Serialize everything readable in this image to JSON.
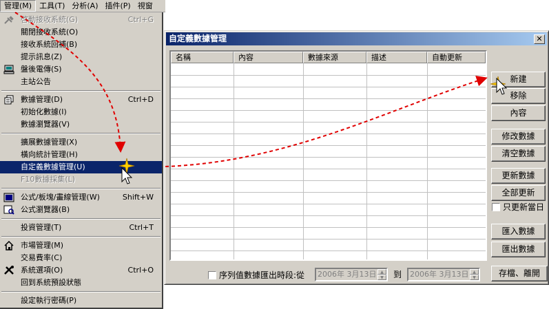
{
  "menubar": {
    "items": [
      {
        "label": "管理(M)"
      },
      {
        "label": "工具(T)"
      },
      {
        "label": "分析(A)"
      },
      {
        "label": "插件(P)"
      },
      {
        "label": "視窗"
      }
    ]
  },
  "menu": {
    "items": [
      {
        "label": "啓動接收系統(G)",
        "shortcut": "Ctrl+G",
        "icon": "plug-icon",
        "disabled": true
      },
      {
        "label": "關閉接收系統(O)"
      },
      {
        "label": "接收系統回補(B)"
      },
      {
        "label": "提示訊息(Z)"
      },
      {
        "label": "盤後電傳(S)",
        "icon": "computer-icon"
      },
      {
        "label": "主站公告"
      },
      {
        "label": "數據管理(D)",
        "shortcut": "Ctrl+D",
        "icon": "database-icon"
      },
      {
        "label": "初始化數據(I)"
      },
      {
        "label": "數據瀏覽器(V)"
      },
      {
        "label": "擴展數據管理(X)"
      },
      {
        "label": "橫向統計管理(H)"
      },
      {
        "label": "自定義數據管理(U)"
      },
      {
        "label": "F10數據採集(L)",
        "disabled": true
      },
      {
        "label": "公式/板塊/畫線管理(W)",
        "shortcut": "Shift+W",
        "icon": "formula-icon"
      },
      {
        "label": "公式瀏覽器(B)",
        "icon": "browser-icon"
      },
      {
        "label": "投資管理(T)",
        "shortcut": "Ctrl+T"
      },
      {
        "label": "市場管理(M)",
        "icon": "home-icon"
      },
      {
        "label": "交易費率(C)"
      },
      {
        "label": "系統選項(O)",
        "shortcut": "Ctrl+O",
        "icon": "tools-icon"
      },
      {
        "label": "回到系統預設狀態"
      },
      {
        "label": "設定執行密碼(P)"
      }
    ]
  },
  "dialog": {
    "title": "自定義數據管理",
    "close_glyph": "✕",
    "columns": [
      "名稱",
      "內容",
      "數據來源",
      "描述",
      "自動更新"
    ],
    "buttons": {
      "new": "新建",
      "delete": "移除",
      "content": "內容",
      "modify": "修改數據",
      "clear": "清空數據",
      "update": "更新數據",
      "update_all": "全部更新",
      "only_today": "只更新當日",
      "import": "匯入數據",
      "export": "匯出數據",
      "save_exit": "存檔、離開"
    },
    "range_label": "序列值數據匯出時段:從",
    "date_from": "2006年  3月13日",
    "to_label": "到",
    "date_to": "2006年  3月13日"
  },
  "colors": {
    "menu_highlight": "#0a246a",
    "arrow": "#e00000"
  }
}
